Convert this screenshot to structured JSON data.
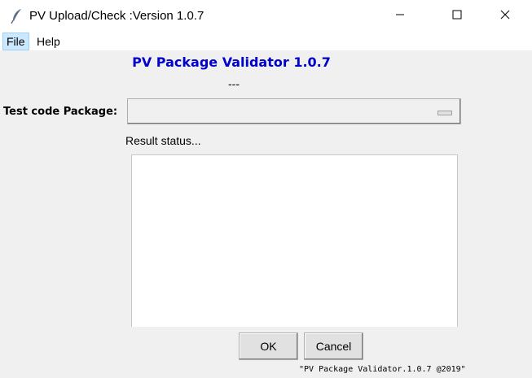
{
  "window": {
    "title": "PV Upload/Check :Version 1.0.7",
    "icon": "feather-icon",
    "controls": [
      "minimize-icon",
      "maximize-icon",
      "close-icon"
    ]
  },
  "menu": {
    "items": [
      {
        "label": "File",
        "active": true
      },
      {
        "label": "Help",
        "active": false
      }
    ]
  },
  "main": {
    "heading": "PV Package Validator 1.0.7",
    "subheading": "---",
    "package_label": "Test code Package:",
    "package_value": "",
    "result_label": "Result status...",
    "result_text": ""
  },
  "buttons": {
    "ok_label": "OK",
    "cancel_label": "Cancel"
  },
  "footer": {
    "text": "\"PV Package Validator.1.0.7 @2019\""
  },
  "colors": {
    "heading": "#0000cc",
    "background": "#f0f0f0",
    "menu_active": "#cce8ff"
  }
}
